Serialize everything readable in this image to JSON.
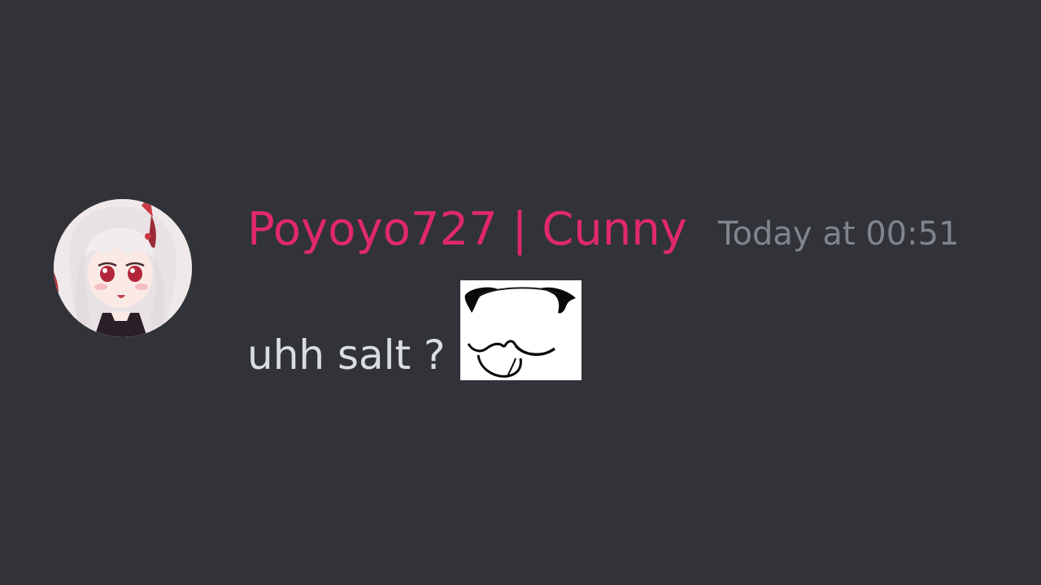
{
  "message": {
    "author": {
      "name": "Poyoyo727 | Cunny",
      "color": "#e0286e",
      "avatar_icon": "anime-girl-avatar"
    },
    "timestamp": "Today at 00:51",
    "content": "uhh salt ?",
    "emoji_icon": "white-blob-face-emoji"
  },
  "theme": {
    "background": "#313338",
    "text": "#dbdee1",
    "timestamp": "#80848e"
  }
}
